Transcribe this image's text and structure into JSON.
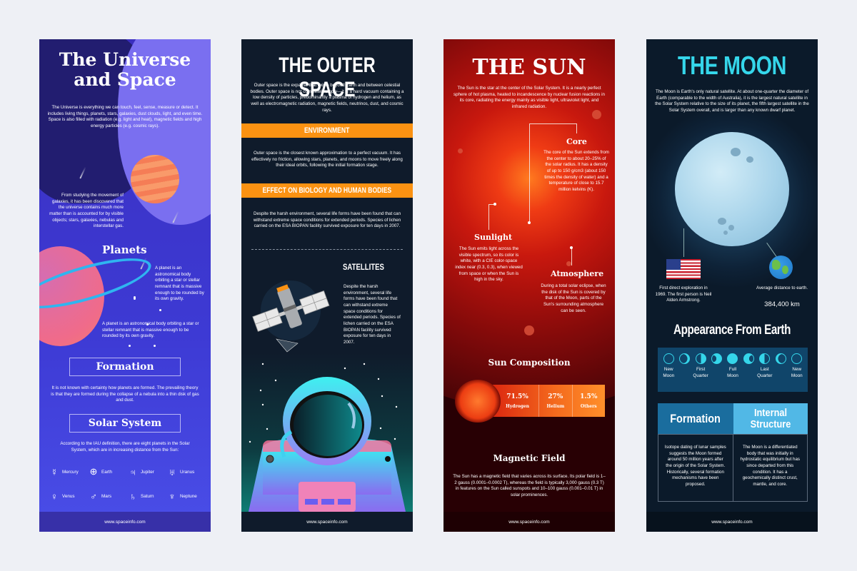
{
  "footer_url": "www.spaceinfo.com",
  "universe": {
    "title": "The Universe and Space",
    "intro": "The Universe is everything we can touch, feel, sense, measure or detect. It includes living things, planets, stars, galaxies, dust clouds, light, and even time. Space is also filled with radiation (e.g. light and heat), magnetic fields and high energy particles (e.g. cosmic rays).",
    "matter_text": "From studying the movement of galaxies, it has been discovered that the universe contains much more matter than is accounted for by visible objects; stars, galaxies, nebulas and interstellar gas.",
    "planets_heading": "Planets",
    "planets_text_1": "A planet is an astronomical body orbiting a star or stellar remnant that is massive enough to be rounded by its own gravity.",
    "planets_text_2": "A planet is an astronomical body orbiting a star or stellar remnant that is massive enough to be rounded by its own gravity.",
    "formation_heading": "Formation",
    "formation_text": "It is not known with certainty how planets are formed. The prevailing theory is that they are formed during the collapse of a nebula into a thin disk of gas and dust.",
    "solar_heading": "Solar System",
    "solar_text": "According to the IAU definition, there are eight planets in the Solar System, which are in increasing distance from the Sun:",
    "planets": [
      {
        "symbol": "☿",
        "name": "Mercury",
        "icon": "mercury-icon"
      },
      {
        "symbol": "⊕",
        "name": "Earth",
        "icon": "earth-icon"
      },
      {
        "symbol": "♃",
        "name": "Jupiter",
        "icon": "jupiter-icon"
      },
      {
        "symbol": "♅",
        "name": "Uranus",
        "icon": "uranus-icon"
      },
      {
        "symbol": "♀",
        "name": "Venus",
        "icon": "venus-icon"
      },
      {
        "symbol": "♂",
        "name": "Mars",
        "icon": "mars-icon"
      },
      {
        "symbol": "♄",
        "name": "Saturn",
        "icon": "saturn-icon"
      },
      {
        "symbol": "♆",
        "name": "Neptune",
        "icon": "neptune-icon"
      }
    ]
  },
  "outer_space": {
    "title": "THE OUTER SPACE",
    "intro": "Outer space is the expanse that exists beyond Earth and between celestial bodies. Outer space is not completely empty—it is a hard vacuum containing a low density of particles, predominantly a plasma of hydrogen and helium, as well as electromagnetic radiation, magnetic fields, neutrinos, dust, and cosmic rays.",
    "environment_heading": "ENVIRONMENT",
    "environment_text": "Outer space is the closest known approximation to a perfect vacuum. It has effectively no friction, allowing stars, planets, and moons to move freely along their ideal orbits, following the initial formation stage.",
    "biology_heading": "EFFECT ON BIOLOGY AND HUMAN BODIES",
    "biology_text": "Despite the harsh environment, several life forms have been found that can withstand extreme space conditions for extended periods. Species of lichen carried on the ESA BIOPAN facility survived exposure for ten days in 2007.",
    "satellites_heading": "SATELLITES",
    "satellites_text": "Despite the harsh environment, several life forms have been found that can withstand extreme space conditions for extended periods. Species of lichen carried on the ESA BIOPAN facility survived exposure for ten days in 2007.",
    "suit_marks": "I    III"
  },
  "sun": {
    "title": "THE SUN",
    "intro": "The Sun is the star at the center of the Solar System. It is a nearly perfect sphere of hot plasma, heated to incandescence by nuclear fusion reactions in its core, radiating the energy mainly as visible light, ultraviolet light, and infrared radiation.",
    "core_heading": "Core",
    "core_text": "The core of the Sun extends from the center to about 20–25% of the solar radius. It has a density of up to 150 g/cm3 (about 150 times the density of water) and a temperature of close to 15.7 million kelvins (K).",
    "sunlight_heading": "Sunlight",
    "sunlight_text": "The Sun emits light across the visible spectrum, so its color is white, with a CIE color-space index near (0.3, 0.3), when viewed from space or when the Sun is high in the sky.",
    "atmosphere_heading": "Atmosphere",
    "atmosphere_text": "During a total solar eclipse, when the disk of the Sun is covered by that of the Moon, parts of the Sun's surrounding atmosphere can be seen.",
    "composition_heading": "Sun Composition",
    "composition": [
      {
        "value": "71.5%",
        "label": "Hydrogen"
      },
      {
        "value": "27%",
        "label": "Helium"
      },
      {
        "value": "1.5%",
        "label": "Others"
      }
    ],
    "magnetic_heading": "Magnetic Field",
    "magnetic_text": "The Sun has a magnetic field that varies across its surface. Its polar field is 1–2 gauss (0.0001–0.0002 T), whereas the field is typically 3,000 gauss (0.3 T) in features on the Sun called sunspots and 10–100 gauss (0.001–0.01 T) in solar prominences."
  },
  "moon": {
    "title": "THE MOON",
    "intro": "The Moon is Earth's only natural satellite. At about one-quarter the diameter of Earth (comparable to the width of Australia), it is the largest natural satellite in the Solar System relative to the size of its planet, the fifth largest satellite in the Solar System overall, and is larger than any known dwarf planet.",
    "exploration_text": "First direct exploration in 1969. The first person is Neil Alden Armstrong.",
    "distance_label": "Average distance to earth.",
    "distance_value": "384,400 km",
    "appearance_heading": "Appearance From Earth",
    "phases": [
      {
        "label": "New\nMoon",
        "fill": "none"
      },
      {
        "label": "",
        "fill": "waxing-crescent"
      },
      {
        "label": "First\nQuarter",
        "fill": "first-quarter"
      },
      {
        "label": "",
        "fill": "waxing-gibbous"
      },
      {
        "label": "Full\nMoon",
        "fill": "full"
      },
      {
        "label": "",
        "fill": "waning-gibbous"
      },
      {
        "label": "Last\nQuarter",
        "fill": "last-quarter"
      },
      {
        "label": "",
        "fill": "waning-crescent"
      },
      {
        "label": "New\nMoon",
        "fill": "none"
      }
    ],
    "formation_heading": "Formation",
    "structure_heading": "Internal Structure",
    "formation_text": "Isotope dating of lunar samples suggests the Moon formed around 50 million years after the origin of the Solar System. Historically, several formation mechanisms have been proposed.",
    "structure_text": "The Moon is a differentiated body that was initially in hydrostatic equilibrium but has since departed from this condition. It has a geochemically distinct crust, mantle, and core."
  },
  "colors": {
    "universe_bg": "#3d3ad4",
    "outer_space_bg": "#0f1b2b",
    "outer_space_accent": "#fb9212",
    "sun_bg": "#280004",
    "moon_bg": "#0b1a2a",
    "moon_accent": "#35d6ea"
  }
}
